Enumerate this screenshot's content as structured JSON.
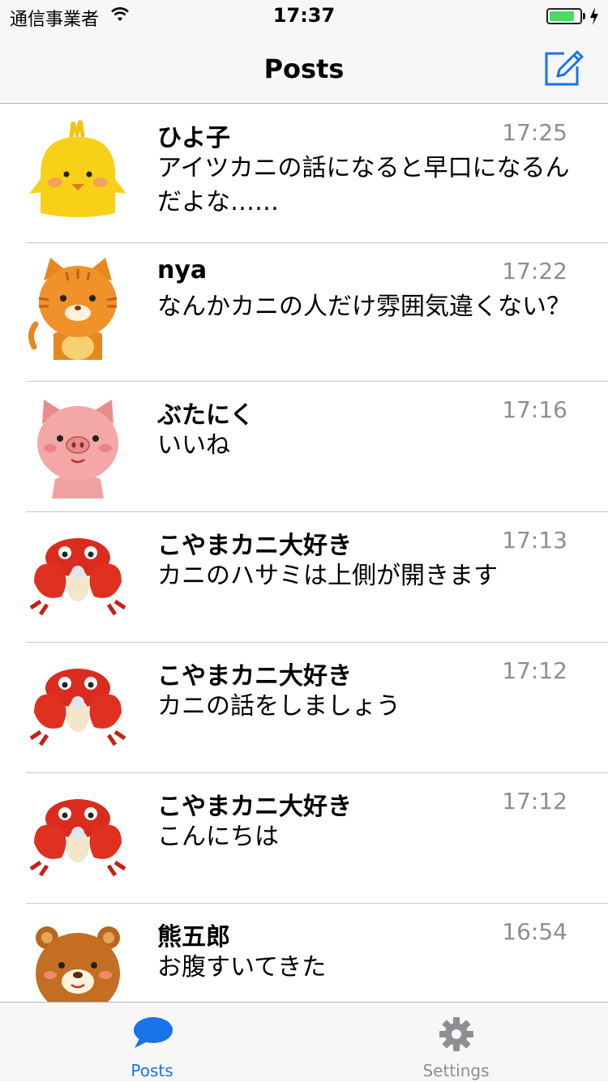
{
  "status_bar": {
    "carrier": "通信事業者",
    "time": "17:37",
    "battery_level": 0.82
  },
  "nav": {
    "title": "Posts",
    "compose_icon": "compose-icon"
  },
  "posts": [
    {
      "name": "ひよ子",
      "time": "17:25",
      "message": "アイツカニの話になると早口になるんだよな……",
      "avatar": "chick-avatar"
    },
    {
      "name": "nya",
      "time": "17:22",
      "message": "なんかカニの人だけ雰囲気違くない？",
      "avatar": "cat-avatar"
    },
    {
      "name": "ぶたにく",
      "time": "17:16",
      "message": "いいね",
      "avatar": "pig-avatar"
    },
    {
      "name": "こやまカニ大好き",
      "time": "17:13",
      "message": "カニのハサミは上側が開きます",
      "avatar": "crab-avatar"
    },
    {
      "name": "こやまカニ大好き",
      "time": "17:12",
      "message": "カニの話をしましょう",
      "avatar": "crab-avatar"
    },
    {
      "name": "こやまカニ大好き",
      "time": "17:12",
      "message": "こんにちは",
      "avatar": "crab-avatar"
    },
    {
      "name": "熊五郎",
      "time": "16:54",
      "message": "お腹すいてきた",
      "avatar": "bear-avatar"
    }
  ],
  "tabs": [
    {
      "label": "Posts",
      "icon": "chat-bubble-icon",
      "active": true
    },
    {
      "label": "Settings",
      "icon": "gear-icon",
      "active": false
    }
  ],
  "colors": {
    "accent": "#1a73e8",
    "secondary_text": "#8e8e93",
    "separator": "#c8c7cc"
  }
}
